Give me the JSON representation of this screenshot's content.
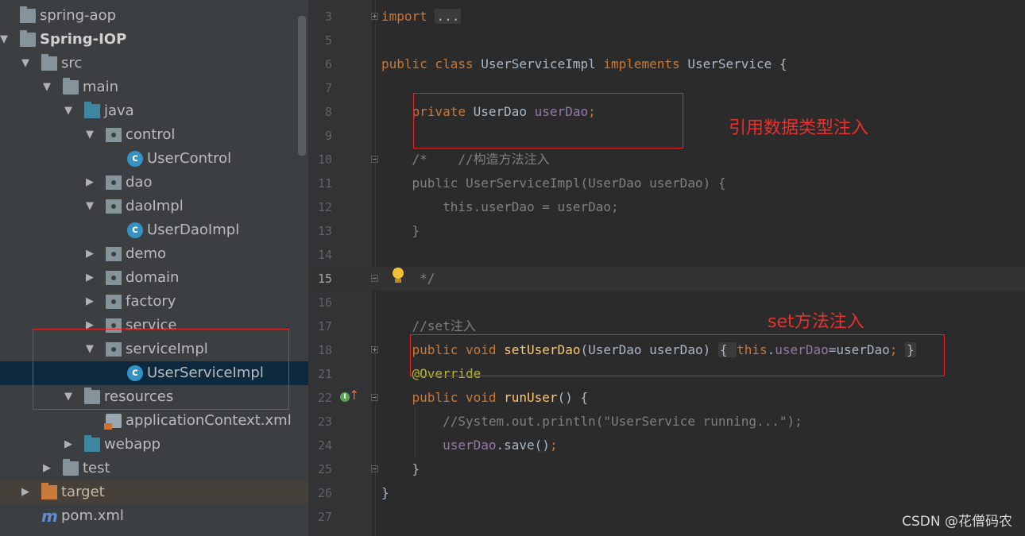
{
  "project_tree": {
    "items": [
      {
        "label": "spring-aop",
        "icon": "module-folder-icon",
        "arrow": "none",
        "indent": 0,
        "bold": false
      },
      {
        "label": "Spring-IOP",
        "icon": "module-folder-icon",
        "arrow": "down",
        "indent": 0,
        "bold": true
      },
      {
        "label": "src",
        "icon": "folder-icon",
        "arrow": "down",
        "indent": 1,
        "bold": false
      },
      {
        "label": "main",
        "icon": "folder-icon",
        "arrow": "down",
        "indent": 2,
        "bold": false
      },
      {
        "label": "java",
        "icon": "source-folder-icon",
        "arrow": "down",
        "indent": 3,
        "bold": false
      },
      {
        "label": "control",
        "icon": "package-icon",
        "arrow": "down",
        "indent": 4,
        "bold": false
      },
      {
        "label": "UserControl",
        "icon": "class-icon",
        "arrow": "none",
        "indent": 5,
        "bold": false
      },
      {
        "label": "dao",
        "icon": "package-icon",
        "arrow": "right",
        "indent": 4,
        "bold": false
      },
      {
        "label": "daoImpl",
        "icon": "package-icon",
        "arrow": "down",
        "indent": 4,
        "bold": false
      },
      {
        "label": "UserDaoImpl",
        "icon": "class-icon",
        "arrow": "none",
        "indent": 5,
        "bold": false
      },
      {
        "label": "demo",
        "icon": "package-icon",
        "arrow": "right",
        "indent": 4,
        "bold": false
      },
      {
        "label": "domain",
        "icon": "package-icon",
        "arrow": "right",
        "indent": 4,
        "bold": false
      },
      {
        "label": "factory",
        "icon": "package-icon",
        "arrow": "right",
        "indent": 4,
        "bold": false
      },
      {
        "label": "service",
        "icon": "package-icon",
        "arrow": "right",
        "indent": 4,
        "bold": false
      },
      {
        "label": "serviceImpl",
        "icon": "package-icon",
        "arrow": "down",
        "indent": 4,
        "bold": false
      },
      {
        "label": "UserServiceImpl",
        "icon": "class-icon",
        "arrow": "none",
        "indent": 5,
        "bold": false,
        "selected": true
      },
      {
        "label": "resources",
        "icon": "resources-folder-icon",
        "arrow": "down",
        "indent": 3,
        "bold": false
      },
      {
        "label": "applicationContext.xml",
        "icon": "xml-file-icon",
        "arrow": "none",
        "indent": 4,
        "bold": false
      },
      {
        "label": "webapp",
        "icon": "web-folder-icon",
        "arrow": "right",
        "indent": 3,
        "bold": false
      },
      {
        "label": "test",
        "icon": "folder-icon",
        "arrow": "right",
        "indent": 2,
        "bold": false
      },
      {
        "label": "target",
        "icon": "excluded-folder-icon",
        "arrow": "right",
        "indent": 1,
        "bold": false,
        "highlight": true
      },
      {
        "label": "pom.xml",
        "icon": "maven-icon",
        "arrow": "none",
        "indent": 1,
        "bold": false
      }
    ]
  },
  "editor": {
    "current_line": "15",
    "lines": [
      {
        "num": "3",
        "tokens": [
          {
            "t": "import ",
            "c": "kw"
          },
          {
            "t": "...",
            "c": "fold"
          }
        ]
      },
      {
        "num": "5",
        "tokens": []
      },
      {
        "num": "6",
        "tokens": [
          {
            "t": "public class ",
            "c": "kw"
          },
          {
            "t": "UserServiceImpl ",
            "c": ""
          },
          {
            "t": "implements ",
            "c": "kw"
          },
          {
            "t": "UserService {",
            "c": ""
          }
        ]
      },
      {
        "num": "7",
        "tokens": []
      },
      {
        "num": "8",
        "tokens": [
          {
            "t": "    private ",
            "c": "kw"
          },
          {
            "t": "UserDao ",
            "c": ""
          },
          {
            "t": "userDao",
            "c": "fld"
          },
          {
            "t": ";",
            "c": "kw"
          }
        ]
      },
      {
        "num": "9",
        "tokens": []
      },
      {
        "num": "10",
        "tokens": [
          {
            "t": "    /*    //构造方法注入",
            "c": "cm"
          }
        ]
      },
      {
        "num": "11",
        "tokens": [
          {
            "t": "    public UserServiceImpl(UserDao userDao) {",
            "c": "cm"
          }
        ]
      },
      {
        "num": "12",
        "tokens": [
          {
            "t": "        this.userDao = userDao;",
            "c": "cm"
          }
        ]
      },
      {
        "num": "13",
        "tokens": [
          {
            "t": "    }",
            "c": "cm"
          }
        ]
      },
      {
        "num": "14",
        "tokens": []
      },
      {
        "num": "15",
        "tokens": [
          {
            "t": "     */",
            "c": "cm"
          }
        ]
      },
      {
        "num": "16",
        "tokens": []
      },
      {
        "num": "17",
        "tokens": [
          {
            "t": "    //set注入",
            "c": "cm"
          }
        ]
      },
      {
        "num": "18",
        "tokens": [
          {
            "t": "    public void ",
            "c": "kw"
          },
          {
            "t": "setUserDao",
            "c": "fn"
          },
          {
            "t": "(UserDao userDao) ",
            "c": ""
          },
          {
            "t": "{ ",
            "c": "fold"
          },
          {
            "t": "this",
            "c": "kw"
          },
          {
            "t": ".",
            "c": ""
          },
          {
            "t": "userDao",
            "c": "fld"
          },
          {
            "t": "=userDao",
            "c": ""
          },
          {
            "t": "; ",
            "c": "kw"
          },
          {
            "t": "}",
            "c": "fold"
          }
        ]
      },
      {
        "num": "21",
        "tokens": [
          {
            "t": "    @Override",
            "c": "ann"
          }
        ]
      },
      {
        "num": "22",
        "tokens": [
          {
            "t": "    public void ",
            "c": "kw"
          },
          {
            "t": "runUser",
            "c": "fn"
          },
          {
            "t": "() {",
            "c": ""
          }
        ]
      },
      {
        "num": "23",
        "tokens": [
          {
            "t": "        //System.out.println(\"UserService running...\");",
            "c": "cm"
          }
        ]
      },
      {
        "num": "24",
        "tokens": [
          {
            "t": "        ",
            "c": ""
          },
          {
            "t": "userDao",
            "c": "fld"
          },
          {
            "t": ".save()",
            "c": ""
          },
          {
            "t": ";",
            "c": "kw"
          }
        ]
      },
      {
        "num": "25",
        "tokens": [
          {
            "t": "    }",
            "c": ""
          }
        ]
      },
      {
        "num": "26",
        "tokens": [
          {
            "t": "}",
            "c": ""
          }
        ]
      },
      {
        "num": "27",
        "tokens": []
      }
    ]
  },
  "annotations": {
    "reference_injection": "引用数据类型注入",
    "set_injection": "set方法注入"
  },
  "watermark": "CSDN @花僧码农",
  "colors": {
    "annotation_red": "#e02828",
    "keyword": "#cc7832",
    "field": "#9876aa",
    "method": "#ffc66d",
    "comment": "#808080"
  }
}
